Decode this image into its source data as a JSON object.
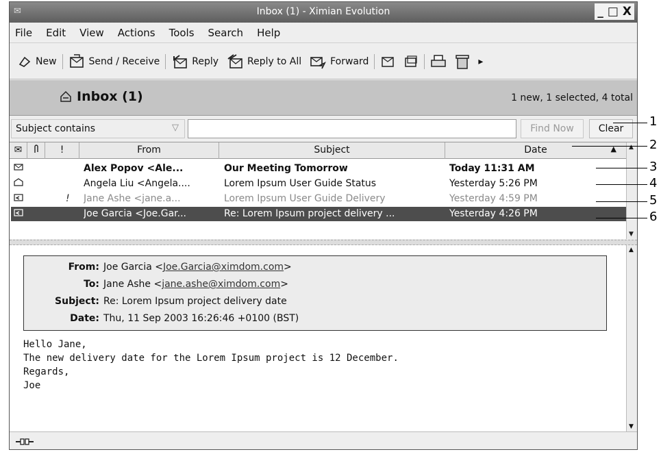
{
  "window": {
    "title": "Inbox (1) - Ximian Evolution",
    "controls": [
      "_",
      "□",
      "X"
    ]
  },
  "menu": [
    "File",
    "Edit",
    "View",
    "Actions",
    "Tools",
    "Search",
    "Help"
  ],
  "toolbar": {
    "new": "New",
    "send_receive": "Send / Receive",
    "reply": "Reply",
    "reply_all": "Reply to All",
    "forward": "Forward",
    "more": "▸"
  },
  "folder": {
    "title": "Inbox (1)",
    "status": "1 new, 1 selected, 4 total"
  },
  "search": {
    "scope": "Subject contains",
    "value": "",
    "find_now": "Find Now",
    "clear": "Clear"
  },
  "columns": {
    "status": "✉",
    "attach": "📎",
    "flag": "!",
    "from": "From",
    "subject": "Subject",
    "date": "Date",
    "sort": "▲"
  },
  "messages": [
    {
      "from": "Alex Popov <Ale...",
      "subject": "Our Meeting Tomorrow",
      "date": "Today 11:31 AM",
      "flag": ""
    },
    {
      "from": "Angela Liu <Angela....",
      "subject": "Lorem Ipsum User Guide Status",
      "date": "Yesterday 5:26 PM",
      "flag": ""
    },
    {
      "from": "Jane Ashe <jane.a...",
      "subject": "Lorem Ipsum User Guide Delivery",
      "date": "Yesterday 4:59 PM",
      "flag": "!"
    },
    {
      "from": "Joe Garcia <Joe.Gar...",
      "subject": "Re: Lorem Ipsum project delivery ...",
      "date": "Yesterday 4:26 PM",
      "flag": ""
    }
  ],
  "preview": {
    "from_label": "From:",
    "from_name": "Joe Garcia <",
    "from_email": "Joe.Garcia@ximdom.com",
    "to_label": "To:",
    "to_name": "Jane Ashe <",
    "to_email": "jane.ashe@ximdom.com",
    "subject_label": "Subject:",
    "subject": "Re: Lorem Ipsum project delivery date",
    "date_label": "Date:",
    "date": "Thu, 11 Sep 2003 16:26:46 +0100 (BST)",
    "gt": ">",
    "body": [
      "Hello Jane,",
      "",
      "The new delivery date for the Lorem Ipsum project is 12 December.",
      "",
      "Regards,",
      "Joe"
    ]
  },
  "callouts": [
    "1",
    "2",
    "3",
    "4",
    "5",
    "6"
  ]
}
